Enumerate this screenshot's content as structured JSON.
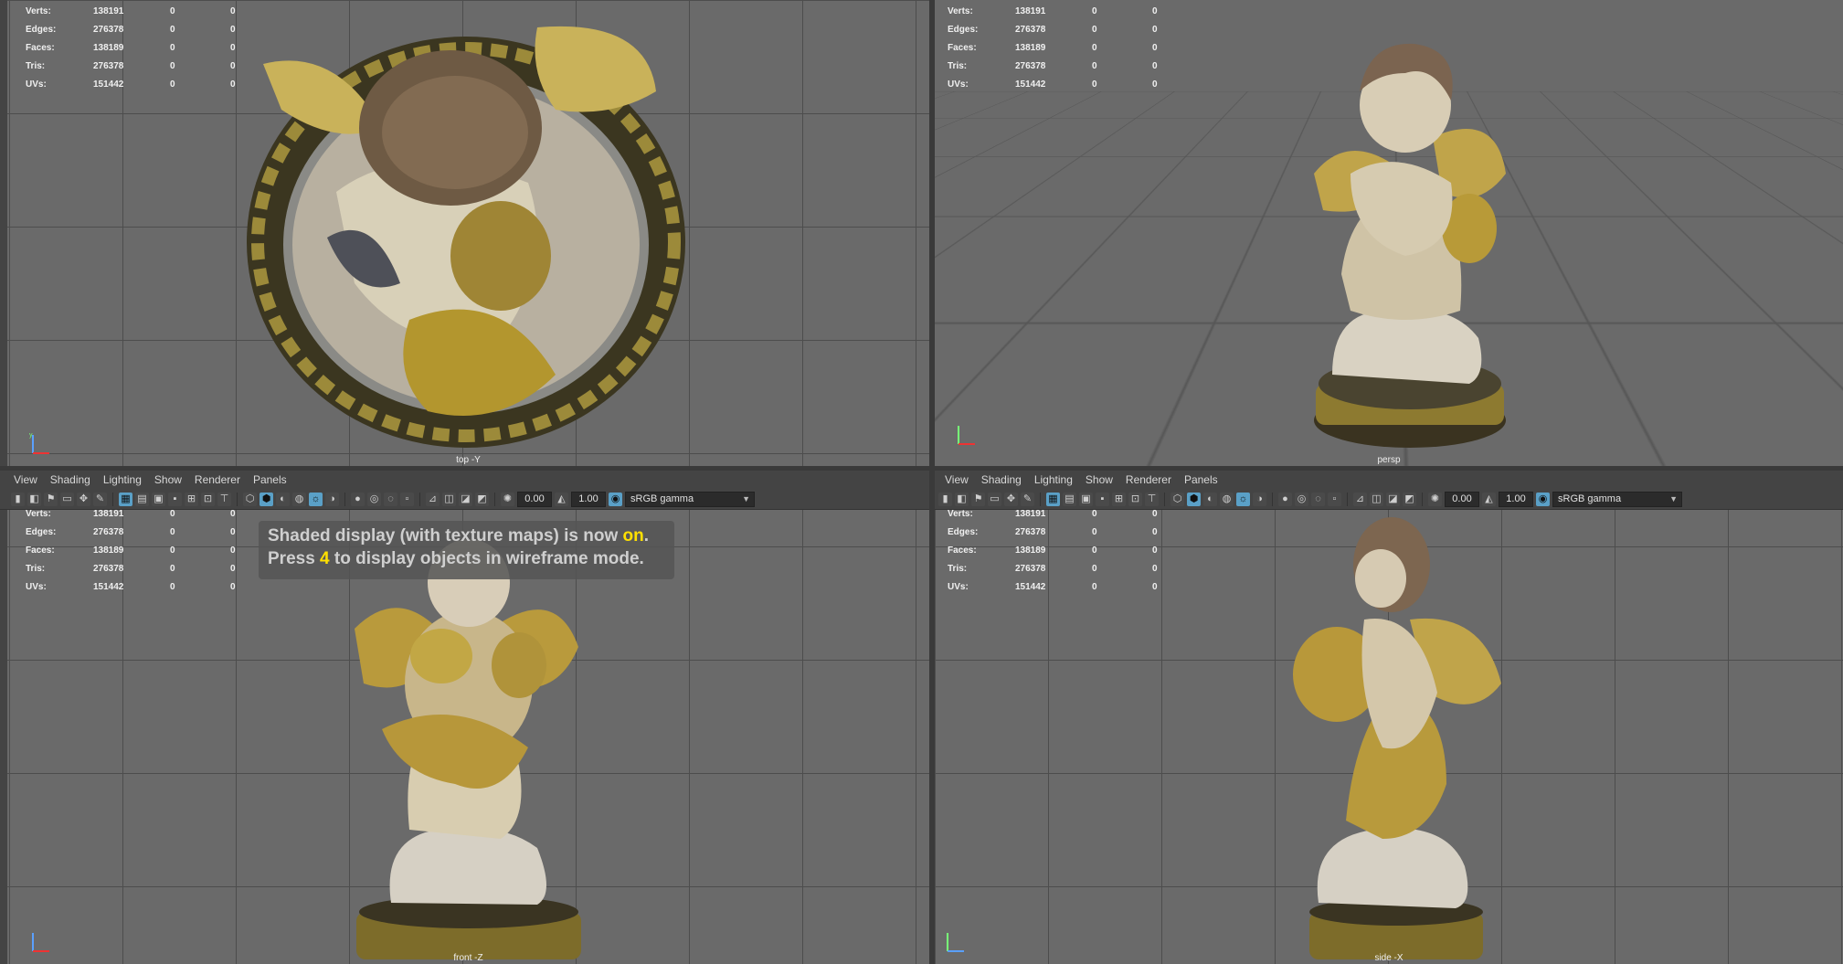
{
  "stats": {
    "rows": [
      {
        "label": "Verts:",
        "total": "138191",
        "sel": "0",
        "tri": "0"
      },
      {
        "label": "Edges:",
        "total": "276378",
        "sel": "0",
        "tri": "0"
      },
      {
        "label": "Faces:",
        "total": "138189",
        "sel": "0",
        "tri": "0"
      },
      {
        "label": "Tris:",
        "total": "276378",
        "sel": "0",
        "tri": "0"
      },
      {
        "label": "UVs:",
        "total": "151442",
        "sel": "0",
        "tri": "0"
      }
    ]
  },
  "viewports": {
    "top_left": {
      "camera": "top -Y"
    },
    "top_right": {
      "camera": "persp"
    },
    "bottom_left": {
      "camera": "front -Z"
    },
    "bottom_right": {
      "camera": "side -X"
    }
  },
  "menu": [
    "View",
    "Shading",
    "Lighting",
    "Show",
    "Renderer",
    "Panels"
  ],
  "toolbar": {
    "exposure": "0.00",
    "gamma": "1.00",
    "color_space": "sRGB gamma"
  },
  "message": {
    "line1_a": "Shaded display (with texture maps) is now ",
    "line1_hl": "on",
    "line1_b": ".",
    "line2_a": "Press ",
    "line2_hl": "4",
    "line2_b": " to display objects in wireframe mode."
  },
  "colors": {
    "viewport_bg": "#6a6a6a",
    "grid": "#4d4d4d",
    "panel": "#444444",
    "active_icon": "#5aa0c7",
    "highlight": "#ffe000"
  }
}
